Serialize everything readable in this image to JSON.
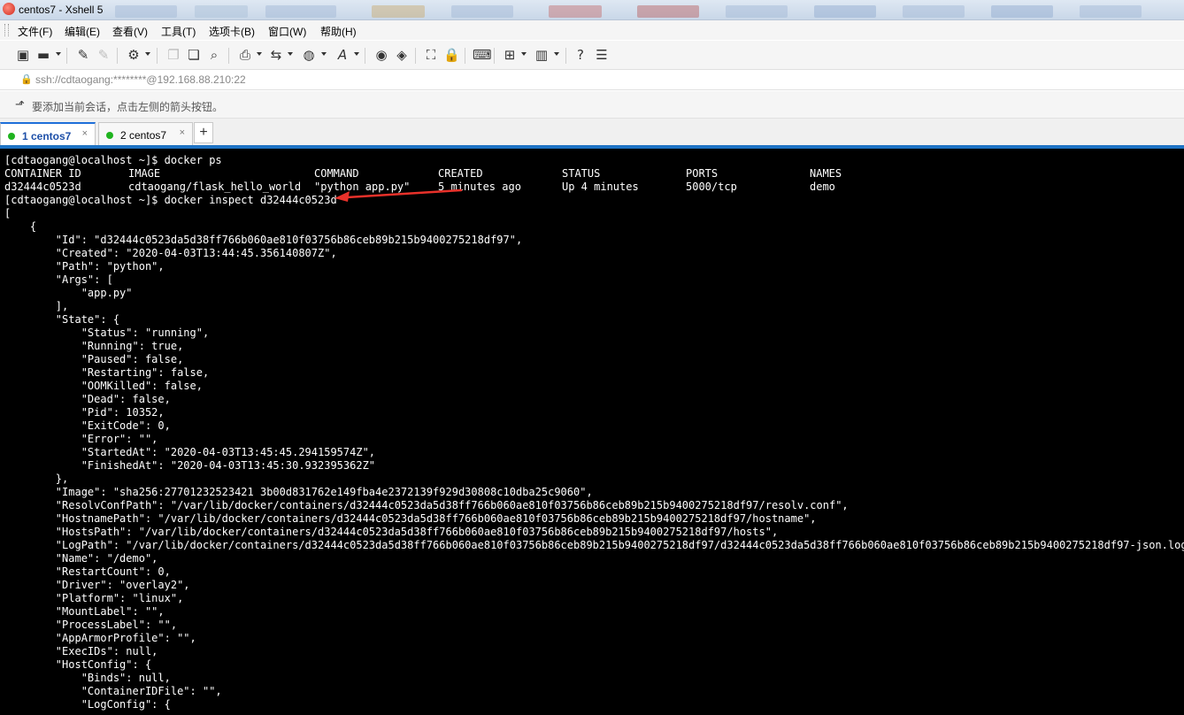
{
  "window": {
    "title": "centos7 - Xshell 5"
  },
  "menu": [
    "文件(F)",
    "编辑(E)",
    "查看(V)",
    "工具(T)",
    "选项卡(B)",
    "窗口(W)",
    "帮助(H)"
  ],
  "address": {
    "url": "ssh://cdtaogang:********@192.168.88.210:22"
  },
  "hint": {
    "text": "要添加当前会话，点击左侧的箭头按钮。"
  },
  "tabs": [
    {
      "label": "1 centos7",
      "close": "×"
    },
    {
      "label": "2 centos7",
      "close": "×"
    }
  ],
  "tab_add": "+",
  "terminal": {
    "ps_command": "[cdtaogang@localhost ~]$ docker ps",
    "ps_headers": [
      "CONTAINER ID",
      "IMAGE",
      "COMMAND",
      "CREATED",
      "STATUS",
      "PORTS",
      "NAMES"
    ],
    "ps_row": [
      "d32444c0523d",
      "cdtaogang/flask_hello_world",
      "\"python app.py\"",
      "5 minutes ago",
      "Up 4 minutes",
      "5000/tcp",
      "demo"
    ],
    "inspect_command": "[cdtaogang@localhost ~]$ docker inspect d32444c0523d",
    "output": [
      "[",
      "    {",
      "        \"Id\": \"d32444c0523da5d38ff766b060ae810f03756b86ceb89b215b9400275218df97\",",
      "        \"Created\": \"2020-04-03T13:44:45.356140807Z\",",
      "        \"Path\": \"python\",",
      "        \"Args\": [",
      "            \"app.py\"",
      "        ],",
      "        \"State\": {",
      "            \"Status\": \"running\",",
      "            \"Running\": true,",
      "            \"Paused\": false,",
      "            \"Restarting\": false,",
      "            \"OOMKilled\": false,",
      "            \"Dead\": false,",
      "            \"Pid\": 10352,",
      "            \"ExitCode\": 0,",
      "            \"Error\": \"\",",
      "            \"StartedAt\": \"2020-04-03T13:45:45.294159574Z\",",
      "            \"FinishedAt\": \"2020-04-03T13:45:30.932395362Z\"",
      "        },",
      "        \"Image\": \"sha256:27701232523421 3b00d831762e149fba4e2372139f929d30808c10dba25c9060\",",
      "        \"ResolvConfPath\": \"/var/lib/docker/containers/d32444c0523da5d38ff766b060ae810f03756b86ceb89b215b9400275218df97/resolv.conf\",",
      "        \"HostnamePath\": \"/var/lib/docker/containers/d32444c0523da5d38ff766b060ae810f03756b86ceb89b215b9400275218df97/hostname\",",
      "        \"HostsPath\": \"/var/lib/docker/containers/d32444c0523da5d38ff766b060ae810f03756b86ceb89b215b9400275218df97/hosts\",",
      "        \"LogPath\": \"/var/lib/docker/containers/d32444c0523da5d38ff766b060ae810f03756b86ceb89b215b9400275218df97/d32444c0523da5d38ff766b060ae810f03756b86ceb89b215b9400275218df97-json.log\",",
      "        \"Name\": \"/demo\",",
      "        \"RestartCount\": 0,",
      "        \"Driver\": \"overlay2\",",
      "        \"Platform\": \"linux\",",
      "        \"MountLabel\": \"\",",
      "        \"ProcessLabel\": \"\",",
      "        \"AppArmorProfile\": \"\",",
      "        \"ExecIDs\": null,",
      "        \"HostConfig\": {",
      "            \"Binds\": null,",
      "            \"ContainerIDFile\": \"\",",
      "            \"LogConfig\": {"
    ]
  },
  "colors": {
    "terminal_bg": "#000000",
    "terminal_fg": "#ffffff",
    "accent": "#1e73c4",
    "arrow": "#e8312a",
    "status_dot": "#1fb31f"
  }
}
